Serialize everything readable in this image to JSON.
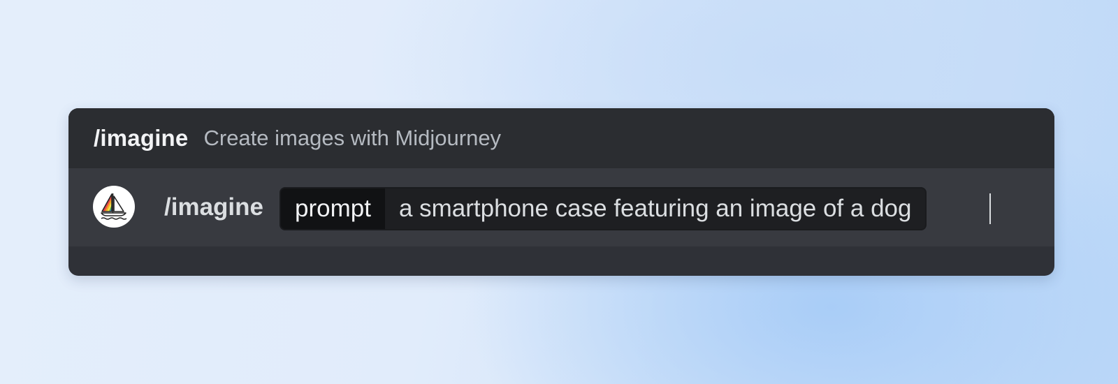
{
  "suggestion": {
    "command": "/imagine",
    "description": "Create images with Midjourney"
  },
  "composer": {
    "app_avatar_icon": "midjourney-sailboat-icon",
    "command": "/imagine",
    "option_name": "prompt",
    "option_value": "a smartphone case featuring an image of a dog"
  },
  "colors": {
    "panel_bg": "#2f3137",
    "header_bg": "#2b2d31",
    "input_row_bg": "#383a40",
    "chip_bg": "#1e1f22",
    "option_name_bg": "#111214",
    "text_primary": "#f2f3f5",
    "text_muted": "#b5bac1"
  }
}
